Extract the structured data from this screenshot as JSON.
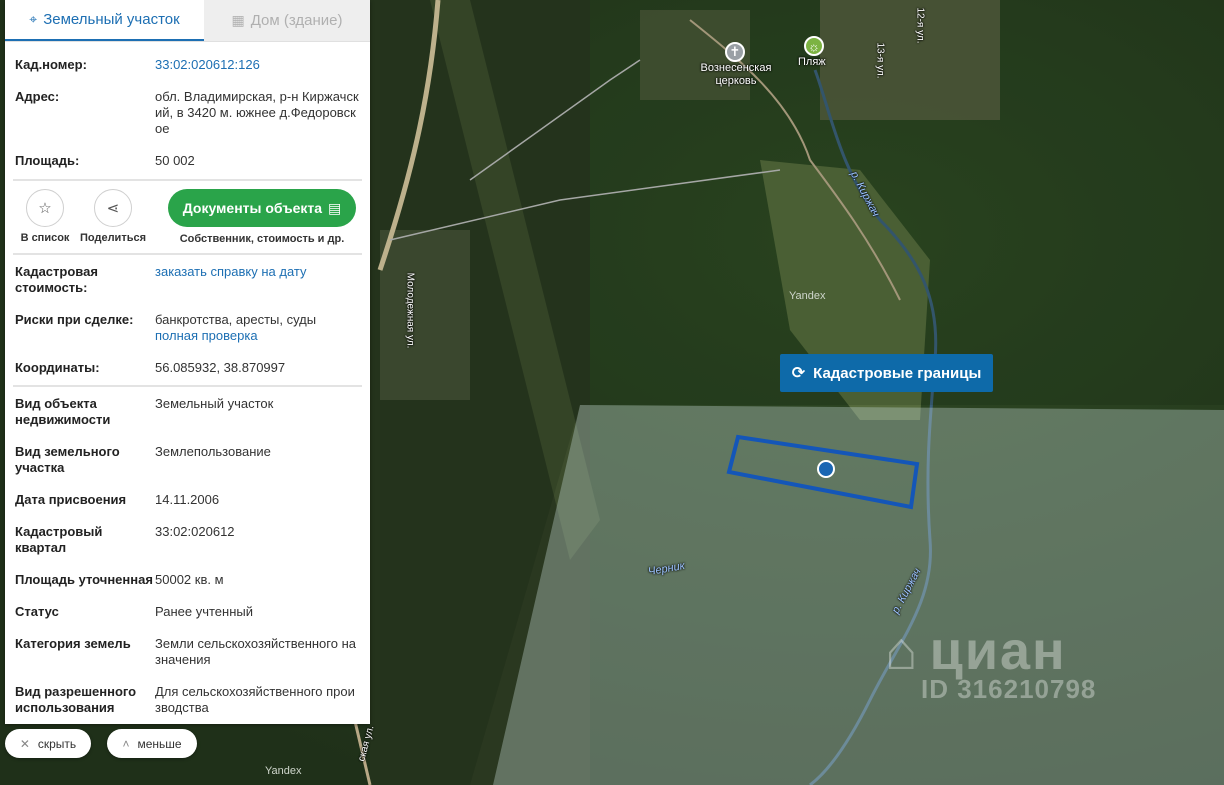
{
  "tabs": {
    "land": {
      "icon": "location-pin-icon",
      "label": "Земельный участок"
    },
    "building": {
      "icon": "building-icon",
      "label": "Дом (здание)"
    }
  },
  "details_top": [
    {
      "label": "Кад.номер:",
      "value": "33:02:020612:126",
      "is_link": true
    },
    {
      "label": "Адрес:",
      "value": "обл. Владимирская, р-н Киржачский, в 3420 м. южнее д.Федоровское"
    },
    {
      "label": "Площадь:",
      "value": "50 002"
    }
  ],
  "actions": {
    "add_to_list": {
      "icon": "star-icon",
      "label": "В список"
    },
    "share": {
      "icon": "share-icon",
      "label": "Поделиться"
    },
    "documents": {
      "label": "Документы объекта",
      "icon": "document-icon",
      "sub": "Собственник, стоимость и др."
    }
  },
  "cadastral_value": {
    "label": "Кадастровая стоимость:",
    "link": "заказать справку на дату"
  },
  "risks": {
    "label": "Риски при сделке:",
    "value": "банкротства, аресты, суды",
    "link": "полная проверка"
  },
  "coordinates": {
    "label": "Координаты:",
    "value": "56.085932, 38.870997"
  },
  "details_bottom": [
    {
      "label": "Вид объекта недвижимости",
      "value": "Земельный участок"
    },
    {
      "label": "Вид земельного участка",
      "value": "Землепользование"
    },
    {
      "label": "Дата присвоения",
      "value": "14.11.2006"
    },
    {
      "label": "Кадастровый квартал",
      "value": "33:02:020612"
    },
    {
      "label": "Площадь уточненная",
      "value": "50002 кв. м"
    },
    {
      "label": "Статус",
      "value": "Ранее учтенный"
    },
    {
      "label": "Категория земель",
      "value": "Земли сельскохозяйственного назначения"
    },
    {
      "label": "Вид разрешенного использования",
      "value": "Для сельскохозяйственного производства"
    }
  ],
  "bottom_buttons": {
    "hide": {
      "icon": "close-icon",
      "label": "скрыть"
    },
    "less": {
      "icon": "chevron-up-icon",
      "label": "меньше"
    }
  },
  "map": {
    "cadastral_button": {
      "icon": "refresh-icon",
      "label": "Кадастровые границы"
    },
    "labels": {
      "church": "Вознесенская церковь",
      "beach": "Пляж",
      "river_top": "р. Киржач",
      "river_bottom": "р. Киржач",
      "yandex_mid": "Yandex",
      "yandex_bottom": "Yandex",
      "chernik": "Черник",
      "street": "Молодежная ул.",
      "street_bottom": "ская ул.",
      "street_12": "12-я ул.",
      "street_13": "13-я ул."
    },
    "watermark": {
      "brand": "циан",
      "id": "ID 316210798"
    }
  },
  "colors": {
    "link": "#1d6fb3",
    "green_button": "#2aa44a",
    "cad_button": "#0e6aa9",
    "parcel": "#1456b8"
  }
}
